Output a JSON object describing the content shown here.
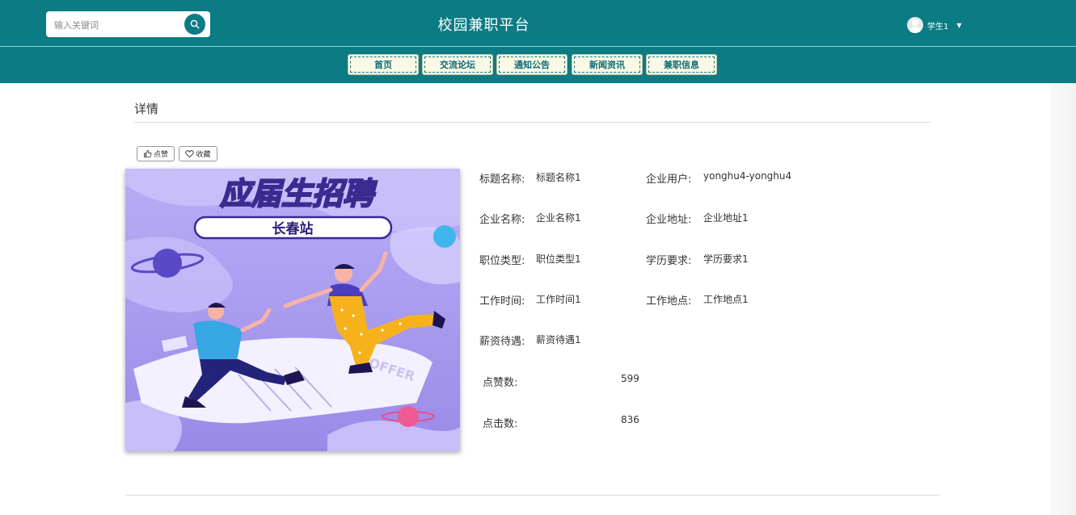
{
  "header": {
    "search_placeholder": "输入关键词",
    "site_title": "校园兼职平台",
    "username": "学生1"
  },
  "nav": [
    {
      "label": "首页"
    },
    {
      "label": "交流论坛"
    },
    {
      "label": "通知公告"
    },
    {
      "label": "新闻资讯"
    },
    {
      "label": "兼职信息"
    }
  ],
  "detail": {
    "section_title": "详情",
    "like_button": "点赞",
    "favorite_button": "收藏",
    "poster": {
      "headline": "应届生招聘",
      "station": "长春站",
      "paper_text": "OFFER"
    },
    "fields": [
      {
        "label": "标题名称:",
        "value": "标题名称1"
      },
      {
        "label": "企业用户:",
        "value": "yonghu4-yonghu4"
      },
      {
        "label": "企业名称:",
        "value": "企业名称1"
      },
      {
        "label": "企业地址:",
        "value": "企业地址1"
      },
      {
        "label": "职位类型:",
        "value": "职位类型1"
      },
      {
        "label": "学历要求:",
        "value": "学历要求1"
      },
      {
        "label": "工作时间:",
        "value": "工作时间1"
      },
      {
        "label": "工作地点:",
        "value": "工作地点1"
      },
      {
        "label": "薪资待遇:",
        "value": "薪资待遇1"
      }
    ],
    "stats": [
      {
        "label": "点赞数:",
        "value": "599"
      },
      {
        "label": "点击数:",
        "value": "836"
      }
    ]
  },
  "colors": {
    "header_bg": "#0b7b84",
    "nav_button_bg": "#fbf8e6",
    "poster_bg": "#a99af0"
  }
}
